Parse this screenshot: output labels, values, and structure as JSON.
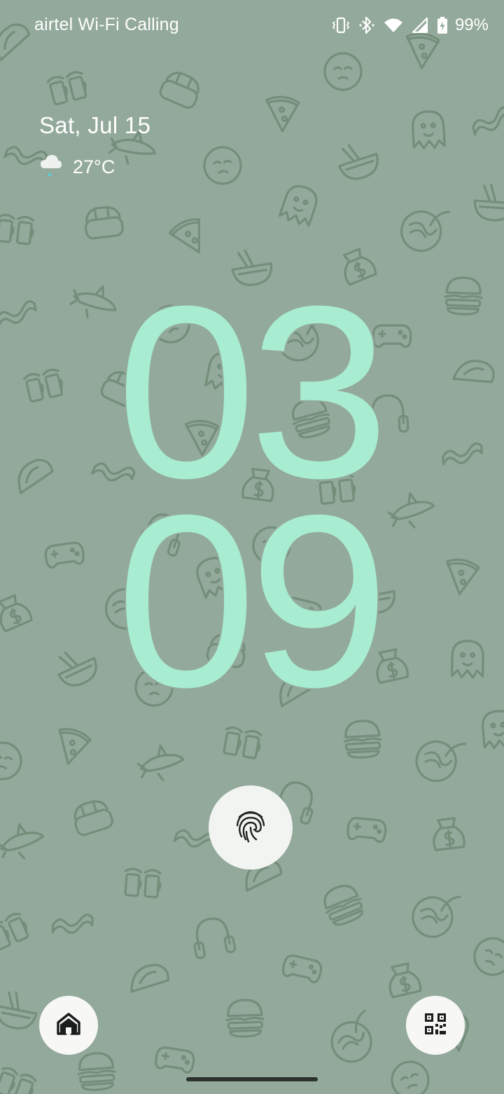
{
  "status_bar": {
    "carrier": "airtel Wi-Fi Calling",
    "battery_percent": "99%",
    "icons": [
      "vibrate-icon",
      "bluetooth-icon",
      "wifi-icon",
      "cellular-signal-icon",
      "battery-charging-icon"
    ]
  },
  "lockscreen": {
    "date": "Sat, Jul 15",
    "weather": {
      "icon": "cloudy-rain-icon",
      "temperature": "27°C"
    },
    "clock": {
      "hours": "03",
      "minutes": "09"
    },
    "fingerprint_icon": "fingerprint-icon"
  },
  "shortcuts": {
    "left": "home-icon",
    "right": "qr-code-scanner-icon"
  },
  "colors": {
    "wallpaper_bg": "#93a99b",
    "doodle": "#6f8a76",
    "clock_digits": "#a8ecd2",
    "button_bg": "#f7f8f6"
  }
}
